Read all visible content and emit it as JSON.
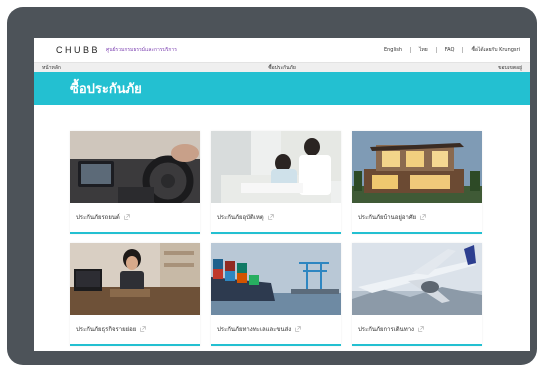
{
  "header": {
    "logo": "CHUBB",
    "tagline": "ศูนย์รวมกรมธรรม์และการบริการ",
    "links": [
      "English",
      "ไทย",
      "FAQ",
      "ซื้อได้เลยกับ Krungsri"
    ]
  },
  "nav": {
    "home": "หน้าหลัก",
    "buy": "ซื้อประกันภัย",
    "more": "ขอบเขตอยู่"
  },
  "hero": {
    "title": "ซื้อประกันภัย"
  },
  "cards": [
    {
      "label": "ประกันภัยรถยนต์"
    },
    {
      "label": "ประกันภัยอุบัติเหตุ"
    },
    {
      "label": "ประกันภัยบ้านอยู่อาศัย"
    },
    {
      "label": "ประกันภัยธุรกิจรายย่อย"
    },
    {
      "label": "ประกันภัยทางทะเลและขนส่ง"
    },
    {
      "label": "ประกันภัยการเดินทาง"
    }
  ],
  "colors": {
    "accent": "#23c0d1",
    "frame": "#4d5359",
    "tagline": "#7b3fb0"
  }
}
